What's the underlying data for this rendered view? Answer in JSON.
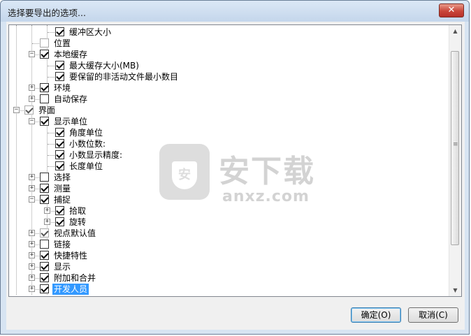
{
  "dialog": {
    "title": "选择要导出的选项...",
    "close_icon": "✕",
    "ok_label": "确定(O)",
    "cancel_label": "取消(C)"
  },
  "tree": {
    "items": [
      {
        "label": "缓冲区大小",
        "checked": true,
        "level": 3,
        "expander": null
      },
      {
        "label": "位置",
        "checked": false,
        "disabled": true,
        "level": 2,
        "expander": null
      },
      {
        "label": "本地缓存",
        "checked": true,
        "level": 2,
        "expander": "minus"
      },
      {
        "label": "最大缓存大小(MB)",
        "checked": true,
        "level": 3,
        "expander": null
      },
      {
        "label": "要保留的非活动文件最小数目",
        "checked": true,
        "level": 3,
        "expander": null
      },
      {
        "label": "环境",
        "checked": true,
        "level": 2,
        "expander": "plus"
      },
      {
        "label": "自动保存",
        "checked": false,
        "level": 2,
        "expander": "plus"
      },
      {
        "label": "界面",
        "checked": true,
        "disabled": true,
        "level": 1,
        "expander": "minus"
      },
      {
        "label": "显示单位",
        "checked": true,
        "level": 2,
        "expander": "minus"
      },
      {
        "label": "角度单位",
        "checked": true,
        "level": 3,
        "expander": null
      },
      {
        "label": "小数位数:",
        "checked": true,
        "level": 3,
        "expander": null
      },
      {
        "label": "小数显示精度:",
        "checked": true,
        "level": 3,
        "expander": null
      },
      {
        "label": "长度单位",
        "checked": true,
        "level": 3,
        "expander": null
      },
      {
        "label": "选择",
        "checked": false,
        "level": 2,
        "expander": "plus"
      },
      {
        "label": "测量",
        "checked": true,
        "level": 2,
        "expander": "plus"
      },
      {
        "label": "捕捉",
        "checked": true,
        "level": 2,
        "expander": "minus"
      },
      {
        "label": "拾取",
        "checked": true,
        "level": 3,
        "expander": "plus"
      },
      {
        "label": "旋转",
        "checked": true,
        "level": 3,
        "expander": "plus"
      },
      {
        "label": "视点默认值",
        "checked": true,
        "disabled": true,
        "level": 2,
        "expander": "plus"
      },
      {
        "label": "链接",
        "checked": false,
        "level": 2,
        "expander": "plus"
      },
      {
        "label": "快捷特性",
        "checked": true,
        "level": 2,
        "expander": "plus"
      },
      {
        "label": "显示",
        "checked": true,
        "level": 2,
        "expander": "plus"
      },
      {
        "label": "附加和合并",
        "checked": true,
        "level": 2,
        "expander": "plus"
      },
      {
        "label": "开发人员",
        "checked": true,
        "level": 2,
        "expander": "plus",
        "selected": true
      }
    ]
  },
  "scrollbar": {
    "up_icon": "▲",
    "down_icon": "▼",
    "grip_icon": "≡",
    "position": 0.1
  },
  "watermark": {
    "icon_glyph": "安",
    "text": "安下载",
    "sub": "anxz.com"
  }
}
